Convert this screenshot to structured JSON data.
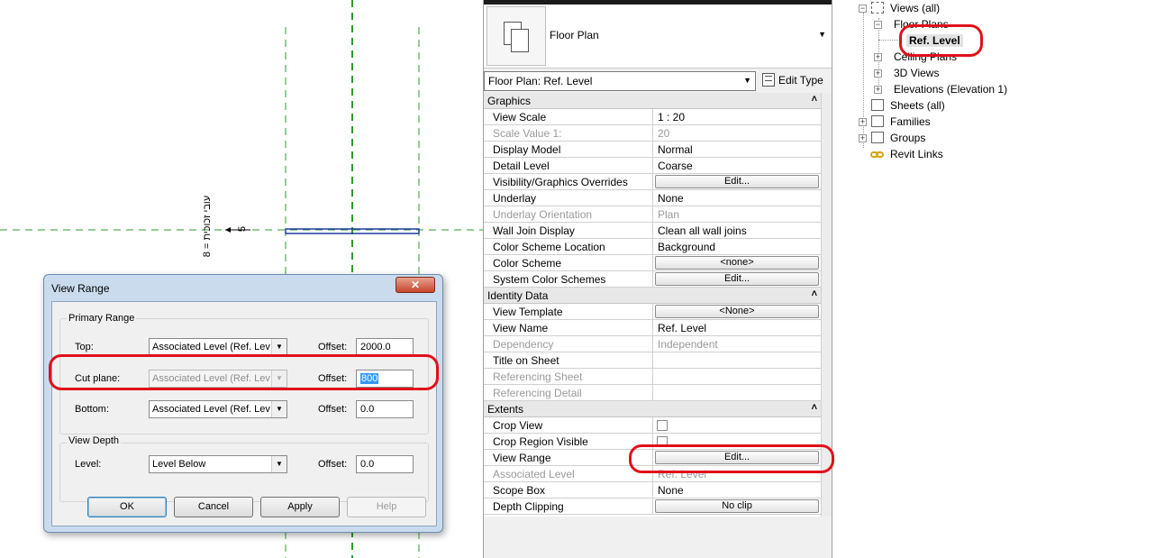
{
  "canvas": {
    "annotation_text": "עובי זכוכית = 8",
    "dimension_value": "5"
  },
  "properties": {
    "type_name": "Floor Plan",
    "instance_selector": "Floor Plan: Ref. Level",
    "edit_type": "Edit Type",
    "rows": [
      {
        "kind": "section",
        "label": "Graphics"
      },
      {
        "name": "View Scale",
        "value": "1 : 20"
      },
      {
        "name": "Scale Value    1:",
        "value": "20",
        "disabled": true
      },
      {
        "name": "Display Model",
        "value": "Normal"
      },
      {
        "name": "Detail Level",
        "value": "Coarse"
      },
      {
        "name": "Visibility/Graphics Overrides",
        "button": "Edit..."
      },
      {
        "name": "Underlay",
        "value": "None"
      },
      {
        "name": "Underlay Orientation",
        "value": "Plan",
        "disabled": true
      },
      {
        "name": "Wall Join Display",
        "value": "Clean all wall joins"
      },
      {
        "name": "Color Scheme Location",
        "value": "Background"
      },
      {
        "name": "Color Scheme",
        "button": "<none>"
      },
      {
        "name": "System Color Schemes",
        "button": "Edit..."
      },
      {
        "kind": "section",
        "label": "Identity Data"
      },
      {
        "name": "View Template",
        "button": "<None>"
      },
      {
        "name": "View Name",
        "value": "Ref. Level"
      },
      {
        "name": "Dependency",
        "value": "Independent",
        "disabled": true
      },
      {
        "name": "Title on Sheet",
        "value": ""
      },
      {
        "name": "Referencing Sheet",
        "value": "",
        "disabled": true
      },
      {
        "name": "Referencing Detail",
        "value": "",
        "disabled": true
      },
      {
        "kind": "section",
        "label": "Extents"
      },
      {
        "name": "Crop View",
        "checkbox": true
      },
      {
        "name": "Crop Region Visible",
        "checkbox": true
      },
      {
        "name": "View Range",
        "button": "Edit..."
      },
      {
        "name": "Associated Level",
        "value": "Ref. Level",
        "disabled": true
      },
      {
        "name": "Scope Box",
        "value": "None"
      },
      {
        "name": "Depth Clipping",
        "button": "No clip"
      }
    ]
  },
  "browser": {
    "views_all": "Views (all)",
    "floor_plans": "Floor Plans",
    "ref_level": "Ref. Level",
    "ceiling_plans": "Ceiling Plans",
    "views_3d": "3D Views",
    "elevations": "Elevations (Elevation 1)",
    "sheets": "Sheets (all)",
    "families": "Families",
    "groups": "Groups",
    "revit_links": "Revit Links"
  },
  "dialog": {
    "title": "View Range",
    "close": "✕",
    "primary_range": "Primary Range",
    "top_label": "Top:",
    "top_level": "Associated Level (Ref. Lev",
    "top_offset": "2000.0",
    "cut_label": "Cut plane:",
    "cut_level": "Associated Level (Ref. Lev",
    "cut_offset": "800",
    "bottom_label": "Bottom:",
    "bottom_level": "Associated Level (Ref. Lev",
    "bottom_offset": "0.0",
    "offset_label": "Offset:",
    "view_depth": "View Depth",
    "level_label": "Level:",
    "depth_level": "Level Below",
    "depth_offset": "0.0",
    "ok": "OK",
    "cancel": "Cancel",
    "apply": "Apply",
    "help": "Help"
  },
  "colors": {
    "highlight_ring": "#e0101a",
    "grid_line": "#2e9a2e",
    "wall": "#1f3d9e"
  }
}
